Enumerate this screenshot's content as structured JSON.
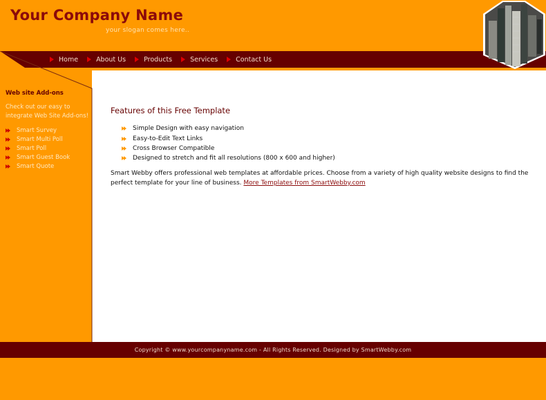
{
  "header": {
    "company_name": "Your Company Name",
    "slogan": "your slogan comes here..",
    "image": "office-buildings-hexagon"
  },
  "nav": {
    "items": [
      {
        "label": "Home"
      },
      {
        "label": "About Us"
      },
      {
        "label": "Products"
      },
      {
        "label": "Services"
      },
      {
        "label": "Contact Us"
      }
    ]
  },
  "sidebar": {
    "title": "Web site Add-ons",
    "intro": "Check out our easy to integrate Web Site Add-ons!",
    "items": [
      {
        "label": "Smart Survey"
      },
      {
        "label": "Smart Multi Poll"
      },
      {
        "label": "Smart Poll"
      },
      {
        "label": "Smart Guest Book"
      },
      {
        "label": "Smart Quote"
      }
    ]
  },
  "main": {
    "title": "Features of this Free Template",
    "features": [
      "Simple Design with easy navigation",
      "Easy-to-Edit Text Links",
      "Cross Browser Compatible",
      "Designed to stretch and fit all resolutions (800 x 600 and higher)"
    ],
    "paragraph": "Smart Webby offers professional web templates at affordable prices. Choose from a variety of high quality website designs to find the perfect template for your line of business. ",
    "link_text": "More Templates from SmartWebby.com"
  },
  "footer": {
    "text": "Copyright © www.yourcompanyname.com - All Rights Reserved. Designed by SmartWebby.com"
  },
  "colors": {
    "primary_orange": "#ff9900",
    "dark_maroon": "#660000",
    "title_red": "#8b0a0a"
  }
}
